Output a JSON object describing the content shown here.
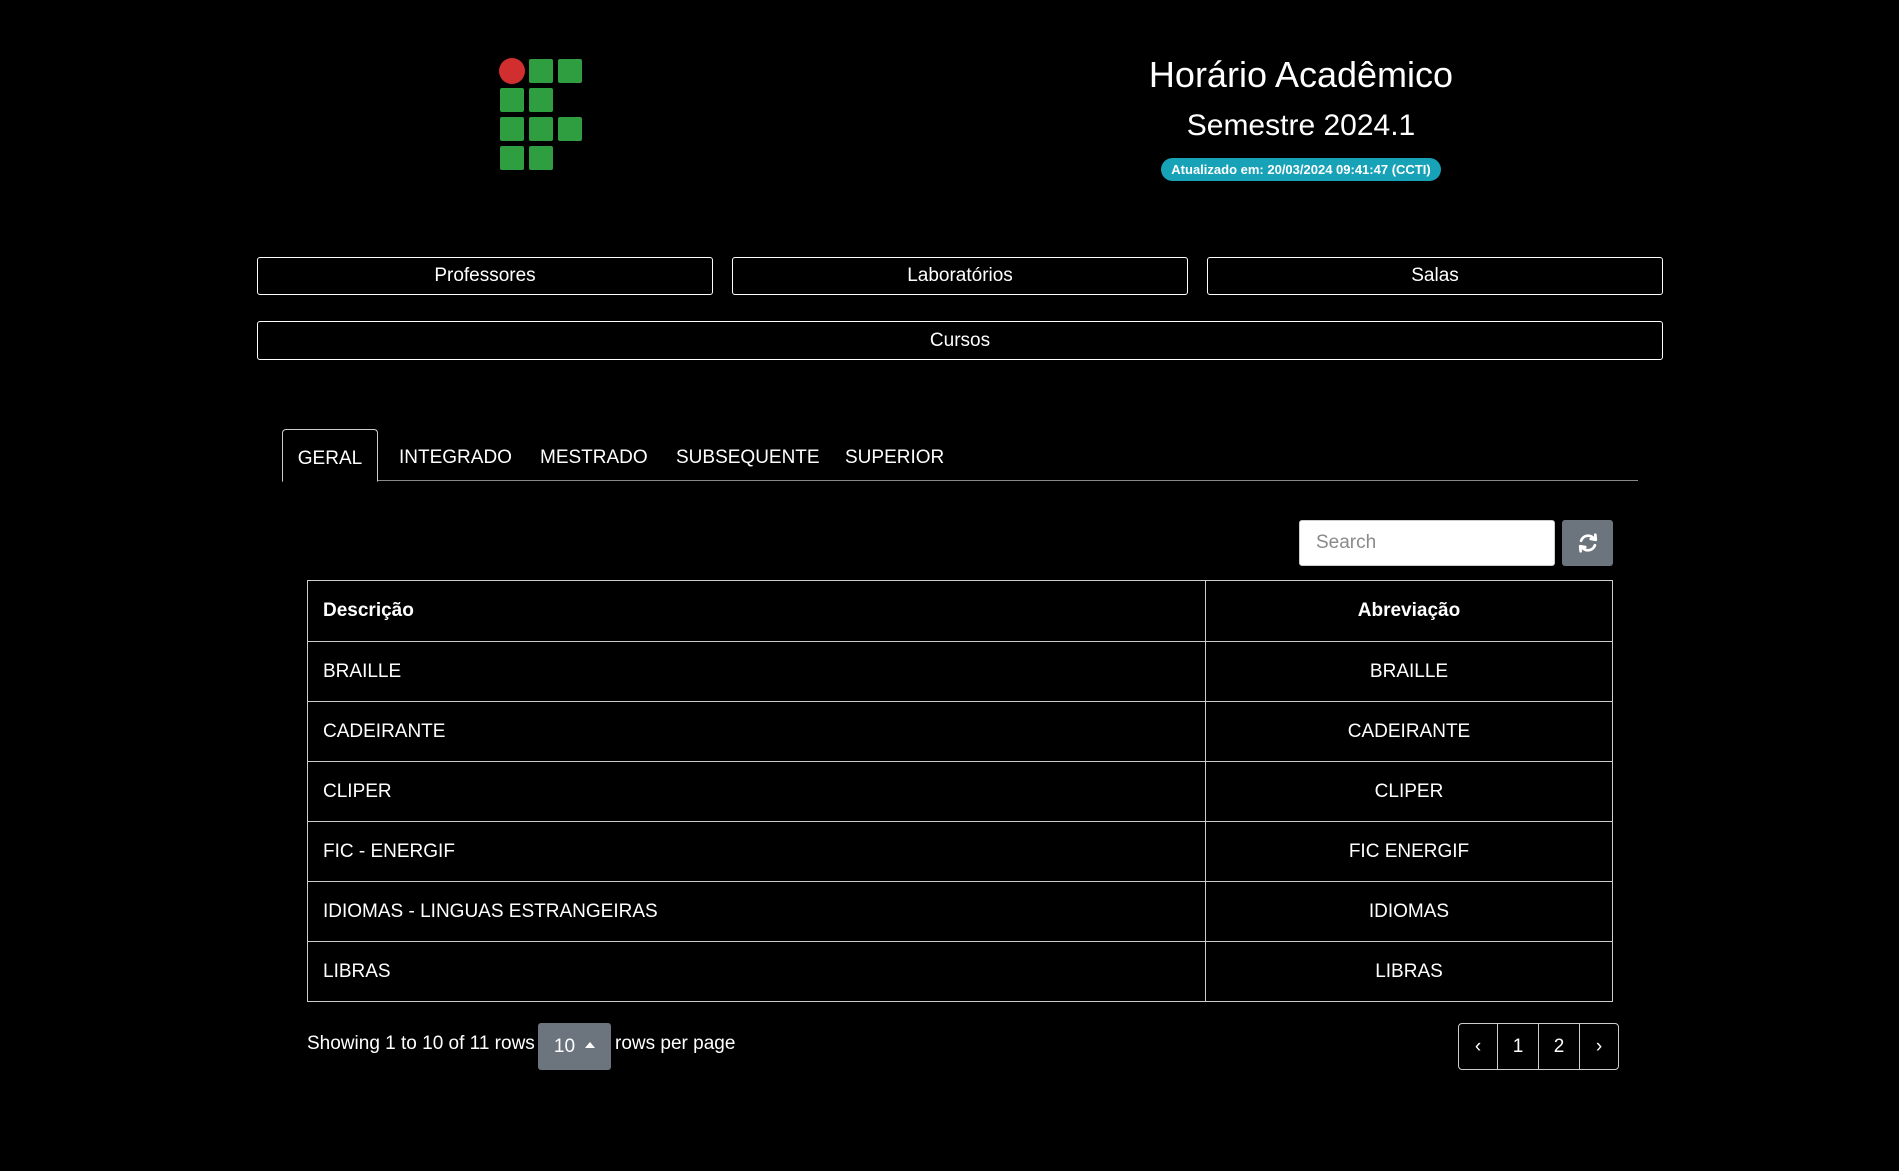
{
  "header": {
    "title": "Horário Acadêmico",
    "semester": "Semestre 2024.1",
    "updated": "Atualizado em: 20/03/2024 09:41:47 (CCTI)"
  },
  "colors": {
    "logo_red": "#d12f2f",
    "logo_green": "#2f9e41",
    "badge": "#17a2b8",
    "secondary_button": "#6c757d"
  },
  "nav": {
    "professores": "Professores",
    "laboratorios": "Laboratórios",
    "salas": "Salas",
    "cursos": "Cursos"
  },
  "tabs": [
    "GERAL",
    "INTEGRADO",
    "MESTRADO",
    "SUBSEQUENTE",
    "SUPERIOR"
  ],
  "active_tab": "GERAL",
  "search": {
    "placeholder": "Search",
    "value": "",
    "refresh_icon": "refresh-icon"
  },
  "table": {
    "headers": {
      "description": "Descrição",
      "abbreviation": "Abreviação"
    },
    "rows": [
      {
        "description": "BRAILLE",
        "abbreviation": "BRAILLE"
      },
      {
        "description": "CADEIRANTE",
        "abbreviation": "CADEIRANTE"
      },
      {
        "description": "CLIPER",
        "abbreviation": "CLIPER"
      },
      {
        "description": "FIC - ENERGIF",
        "abbreviation": "FIC ENERGIF"
      },
      {
        "description": "IDIOMAS - LINGUAS ESTRANGEIRAS",
        "abbreviation": "IDIOMAS"
      },
      {
        "description": "LIBRAS",
        "abbreviation": "LIBRAS"
      }
    ]
  },
  "footer": {
    "showing": "Showing 1 to 10 of 11 rows",
    "page_size": "10",
    "rows_per_page": "rows per page",
    "pagination": {
      "prev": "‹",
      "pages": [
        "1",
        "2"
      ],
      "next": "›"
    }
  }
}
